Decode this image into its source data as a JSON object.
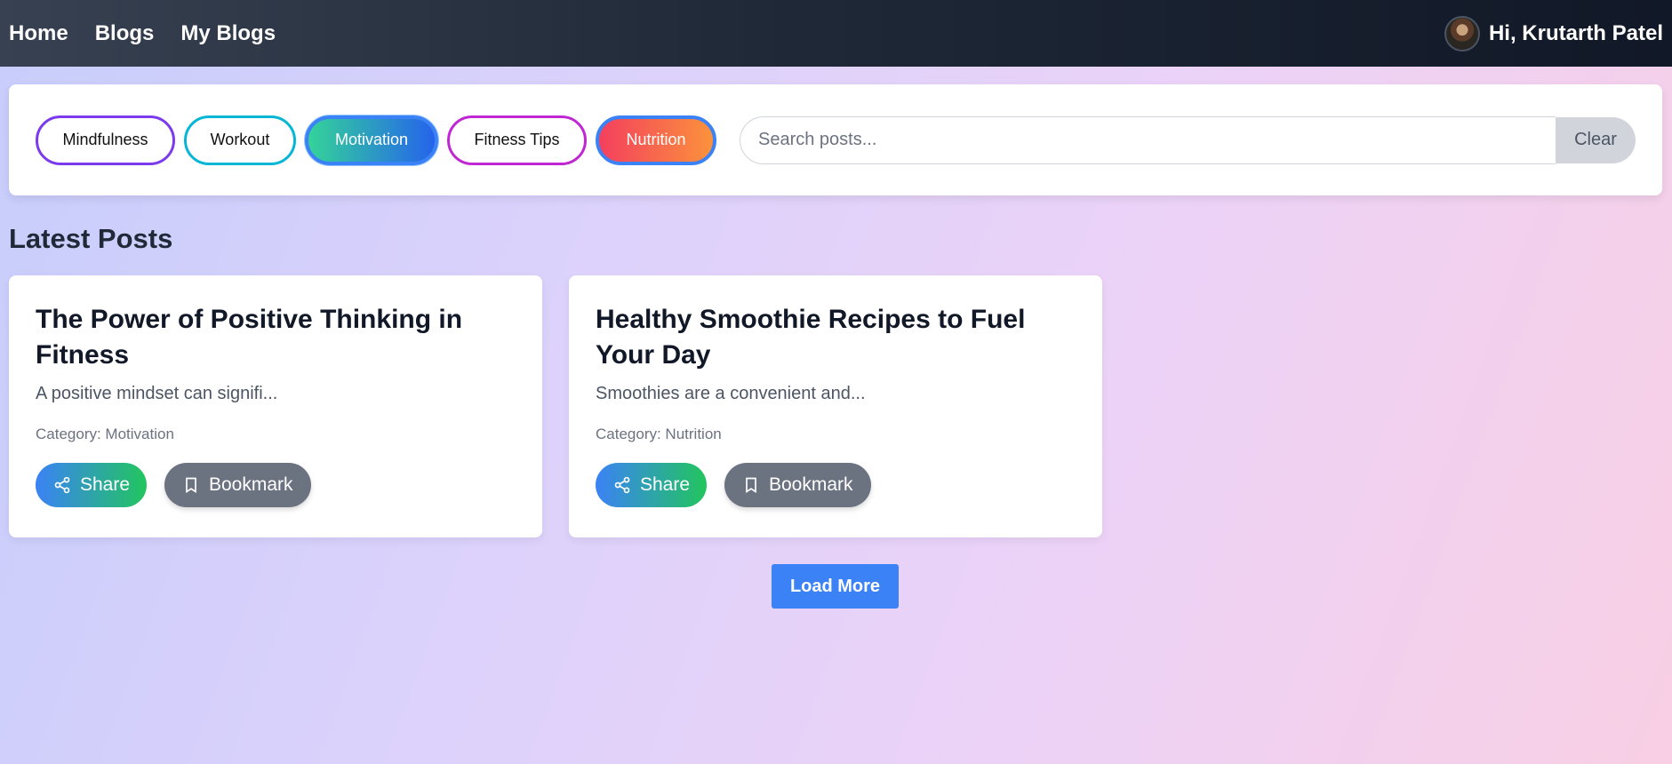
{
  "navbar": {
    "links": [
      {
        "label": "Home"
      },
      {
        "label": "Blogs"
      },
      {
        "label": "My Blogs"
      }
    ],
    "greeting": "Hi, Krutarth Patel"
  },
  "filters": {
    "categories": [
      {
        "label": "Mindfulness",
        "active": false
      },
      {
        "label": "Workout",
        "active": false
      },
      {
        "label": "Motivation",
        "active": true
      },
      {
        "label": "Fitness Tips",
        "active": false
      },
      {
        "label": "Nutrition",
        "active": true
      }
    ],
    "search": {
      "placeholder": "Search posts...",
      "value": ""
    },
    "clear_label": "Clear"
  },
  "section_title": "Latest Posts",
  "posts": [
    {
      "title": "The Power of Positive Thinking in Fitness",
      "excerpt": "A positive mindset can signifi...",
      "category": "Category: Motivation",
      "share_label": "Share",
      "bookmark_label": "Bookmark"
    },
    {
      "title": "Healthy Smoothie Recipes to Fuel Your Day",
      "excerpt": "Smoothies are a convenient and...",
      "category": "Category: Nutrition",
      "share_label": "Share",
      "bookmark_label": "Bookmark"
    }
  ],
  "load_more_label": "Load More",
  "colors": {
    "accent": "#3b82f6",
    "navbar_dark": "#111827",
    "bookmark_gray": "#6b7280"
  },
  "icons": {
    "share": "share-icon",
    "bookmark": "bookmark-icon",
    "avatar": "avatar"
  }
}
